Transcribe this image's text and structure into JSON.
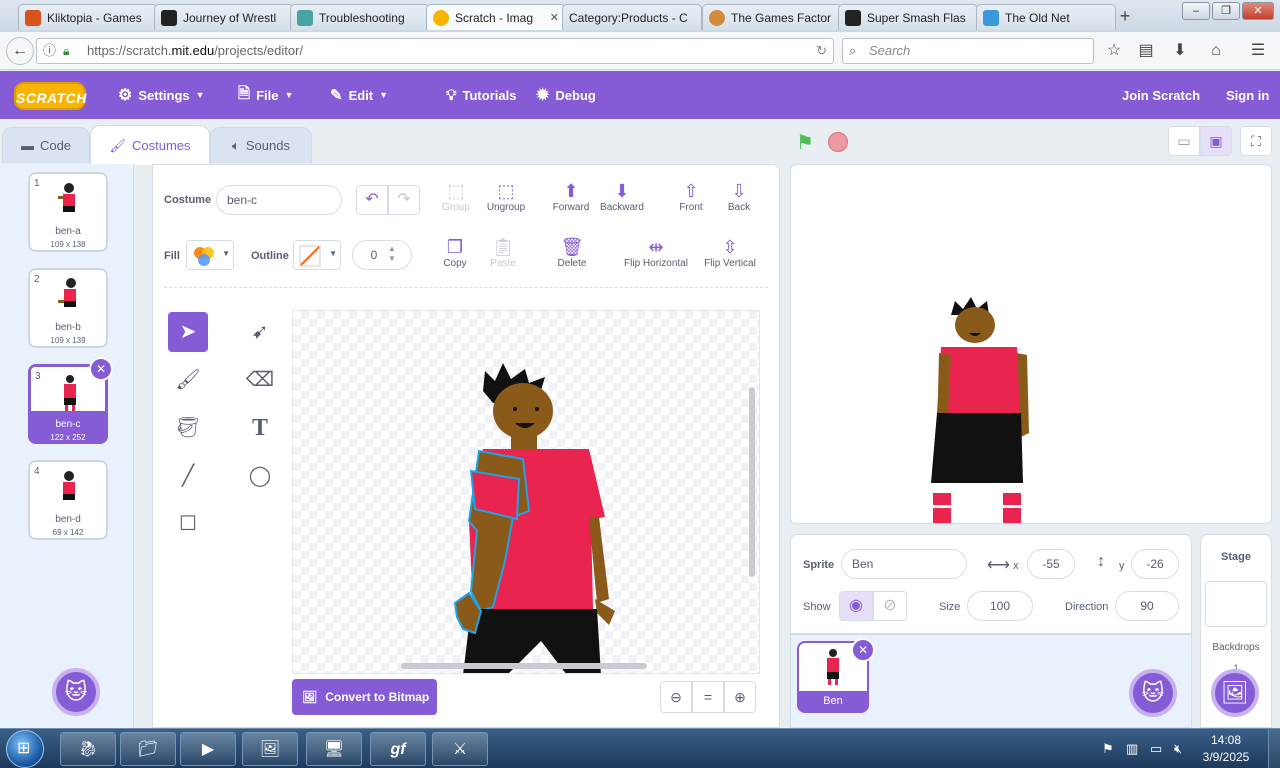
{
  "browser": {
    "tabs": [
      {
        "title": "Kliktopia - Games",
        "color": "#d9531e"
      },
      {
        "title": "Journey of Wrestl",
        "color": "#222222"
      },
      {
        "title": "Troubleshooting",
        "color": "#4aa3a3"
      },
      {
        "title": "Scratch - Imag",
        "color": "#f7b500"
      },
      {
        "title": "Category:Products - C",
        "color": "#e8eef4"
      },
      {
        "title": "The Games Factor",
        "color": "#d28b3a"
      },
      {
        "title": "Super Smash Flas",
        "color": "#222222"
      },
      {
        "title": "The Old Net",
        "color": "#3a9ad9"
      }
    ],
    "url_prefix": "https://scratch.",
    "url_domain": "mit.edu",
    "url_suffix": "/projects/editor/",
    "search_placeholder": "Search"
  },
  "menubar": {
    "logo": "SCRATCH",
    "settings": "Settings",
    "file": "File",
    "edit": "Edit",
    "tutorials": "Tutorials",
    "debug": "Debug",
    "join": "Join Scratch",
    "signin": "Sign in"
  },
  "tabs": {
    "code": "Code",
    "costumes": "Costumes",
    "sounds": "Sounds"
  },
  "costumes": [
    {
      "num": "1",
      "name": "ben-a",
      "size": "109 x 138"
    },
    {
      "num": "2",
      "name": "ben-b",
      "size": "109 x 139"
    },
    {
      "num": "3",
      "name": "ben-c",
      "size": "122 x 252"
    },
    {
      "num": "4",
      "name": "ben-d",
      "size": "69 x 142"
    }
  ],
  "paint": {
    "costume_label": "Costume",
    "costume_name": "ben-c",
    "fill_label": "Fill",
    "outline_label": "Outline",
    "outline_width": "0",
    "group": "Group",
    "ungroup": "Ungroup",
    "forward": "Forward",
    "backward": "Backward",
    "front": "Front",
    "back": "Back",
    "copy": "Copy",
    "paste": "Paste",
    "delete": "Delete",
    "flip_h": "Flip Horizontal",
    "flip_v": "Flip Vertical",
    "convert": "Convert to Bitmap",
    "zoom_reset": "="
  },
  "sprite": {
    "sprite_label": "Sprite",
    "name": "Ben",
    "x_label": "x",
    "x": "-55",
    "y_label": "y",
    "y": "-26",
    "show_label": "Show",
    "size_label": "Size",
    "size": "100",
    "direction_label": "Direction",
    "direction": "90",
    "tile_name": "Ben"
  },
  "stage_panel": {
    "title": "Stage",
    "backdrops": "Backdrops",
    "backdrop_count": "1"
  },
  "taskbar": {
    "time": "14:08",
    "date": "3/9/2025"
  }
}
